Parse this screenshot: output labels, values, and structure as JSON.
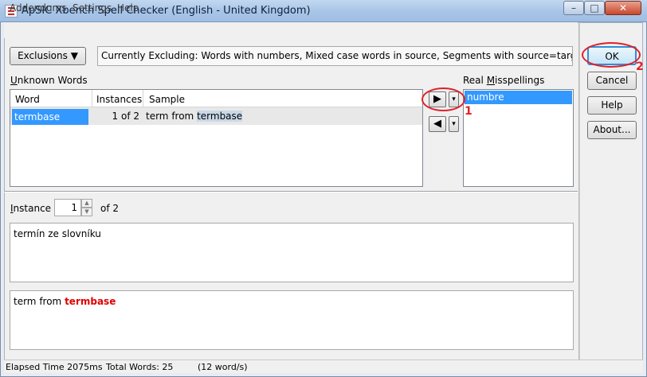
{
  "window": {
    "title": "ApSIC Xbench Spell Checker (English - United Kingdom)",
    "controls": {
      "minimize": "–",
      "maximize": "□",
      "close": "✕"
    }
  },
  "menu": {
    "items": [
      "Addendums",
      "Settings",
      "Help"
    ]
  },
  "toolbar": {
    "exclusions_label": "Exclusions ▼",
    "exclusion_text": "Currently Excluding: Words with numbers, Mixed case words in source, Segments with source=target"
  },
  "unknown_words": {
    "label_first": "U",
    "label_rest": "nknown Words",
    "columns": [
      "Word",
      "Instances",
      "Sample"
    ],
    "rows": [
      {
        "word": "termbase",
        "instances": "1 of 2",
        "sample_prefix": "term from ",
        "sample_term": "termbase"
      }
    ]
  },
  "move_controls": {
    "right_arrow": "▶",
    "left_arrow": "◀",
    "dropdown": "▾"
  },
  "real_misspellings": {
    "label_first": "Real ",
    "label_underline": "M",
    "label_rest": "isspellings",
    "items": [
      "numbre"
    ]
  },
  "buttons": {
    "ok": "OK",
    "cancel": "Cancel",
    "help": "Help",
    "about": "About..."
  },
  "instance": {
    "label_underline": "I",
    "label_rest": "nstance",
    "value": "1",
    "of_text": "of 2",
    "spin_up": "▲",
    "spin_down": "▼"
  },
  "source_text": "termín ze slovníku",
  "target_text": {
    "prefix": "term from ",
    "term": "termbase"
  },
  "status": {
    "elapsed": "Elapsed Time 2075ms",
    "total": "Total Words: 25",
    "rate": "(12 word/s)"
  },
  "annotations": {
    "one": "1",
    "two": "2",
    "color": "#e0202a"
  },
  "colors": {
    "selection": "#3399ff",
    "term_highlight": "#e00000"
  }
}
